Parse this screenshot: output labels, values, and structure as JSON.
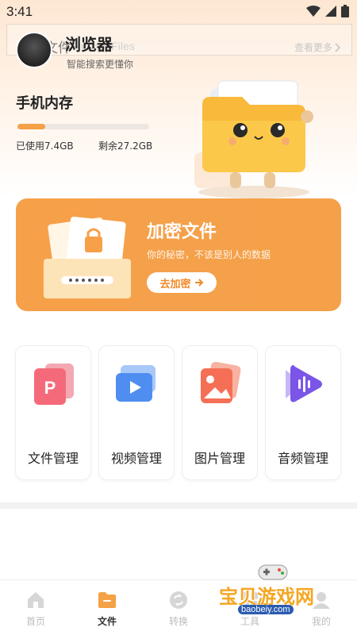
{
  "status_bar": {
    "time": "3:41"
  },
  "header": {
    "browser_title": "浏览器",
    "browser_subtitle": "智能搜索更懂你",
    "recent_title": "最近文件",
    "recent_subtitle": "Recent Files",
    "see_more": "查看更多"
  },
  "storage": {
    "title": "手机内存",
    "used": "已使用7.4GB",
    "free": "剩余27.2GB",
    "used_fraction": 0.21
  },
  "encrypt": {
    "title": "加密文件",
    "description": "你的秘密，不该是别人的数据",
    "button": "去加密"
  },
  "categories": [
    {
      "label": "文件管理",
      "icon": "pdf-file-icon"
    },
    {
      "label": "视频管理",
      "icon": "video-play-icon"
    },
    {
      "label": "图片管理",
      "icon": "image-icon"
    },
    {
      "label": "音频管理",
      "icon": "audio-icon"
    }
  ],
  "tabbar": {
    "items": [
      {
        "label": "首页",
        "icon": "home-icon",
        "active": false
      },
      {
        "label": "文件",
        "icon": "folder-icon",
        "active": true
      },
      {
        "label": "转换",
        "icon": "convert-icon",
        "active": false
      },
      {
        "label": "工具",
        "icon": "tools-icon",
        "active": false
      },
      {
        "label": "我的",
        "icon": "profile-icon",
        "active": false
      }
    ]
  },
  "watermark": {
    "text": "宝贝游戏网",
    "url": "baobeiy.com"
  },
  "colors": {
    "accent": "#f6a04a",
    "active_tab": "#f5a145"
  }
}
